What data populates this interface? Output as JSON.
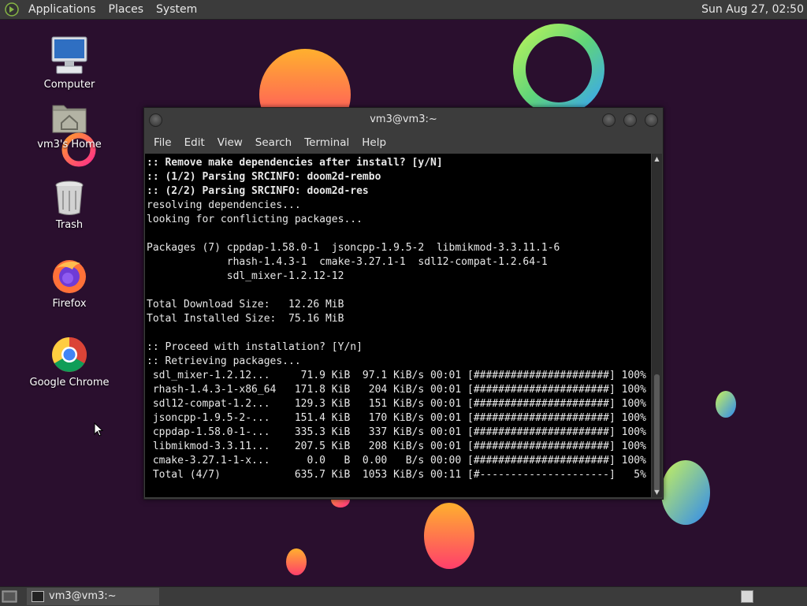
{
  "top_panel": {
    "menus": [
      "Applications",
      "Places",
      "System"
    ],
    "clock": "Sun Aug 27, 02:50"
  },
  "desktop_icons": [
    {
      "label": "Computer",
      "icon": "computer-icon"
    },
    {
      "label": "vm3's Home",
      "icon": "home-folder-icon"
    },
    {
      "label": "Trash",
      "icon": "trash-icon"
    },
    {
      "label": "Firefox",
      "icon": "firefox-icon"
    },
    {
      "label": "Google Chrome",
      "icon": "chrome-icon"
    }
  ],
  "terminal": {
    "title": "vm3@vm3:~",
    "menus": [
      "File",
      "Edit",
      "View",
      "Search",
      "Terminal",
      "Help"
    ],
    "lines": [
      {
        "text": ":: Remove make dependencies after install? [y/N]",
        "bold": true
      },
      {
        "text": ":: (1/2) Parsing SRCINFO: doom2d-rembo",
        "bold": true
      },
      {
        "text": ":: (2/2) Parsing SRCINFO: doom2d-res",
        "bold": true
      },
      {
        "text": "resolving dependencies...",
        "bold": false
      },
      {
        "text": "looking for conflicting packages...",
        "bold": false
      },
      {
        "text": "",
        "bold": false
      },
      {
        "text": "Packages (7) cppdap-1.58.0-1  jsoncpp-1.9.5-2  libmikmod-3.3.11.1-6",
        "bold": false
      },
      {
        "text": "             rhash-1.4.3-1  cmake-3.27.1-1  sdl12-compat-1.2.64-1",
        "bold": false
      },
      {
        "text": "             sdl_mixer-1.2.12-12",
        "bold": false
      },
      {
        "text": "",
        "bold": false
      },
      {
        "text": "Total Download Size:   12.26 MiB",
        "bold": false
      },
      {
        "text": "Total Installed Size:  75.16 MiB",
        "bold": false
      },
      {
        "text": "",
        "bold": false
      },
      {
        "text": ":: Proceed with installation? [Y/n]",
        "bold": false
      },
      {
        "text": ":: Retrieving packages...",
        "bold": false
      },
      {
        "text": " sdl_mixer-1.2.12...     71.9 KiB  97.1 KiB/s 00:01 [######################] 100%",
        "bold": false
      },
      {
        "text": " rhash-1.4.3-1-x86_64   171.8 KiB   204 KiB/s 00:01 [######################] 100%",
        "bold": false
      },
      {
        "text": " sdl12-compat-1.2...    129.3 KiB   151 KiB/s 00:01 [######################] 100%",
        "bold": false
      },
      {
        "text": " jsoncpp-1.9.5-2-...    151.4 KiB   170 KiB/s 00:01 [######################] 100%",
        "bold": false
      },
      {
        "text": " cppdap-1.58.0-1-...    335.3 KiB   337 KiB/s 00:01 [######################] 100%",
        "bold": false
      },
      {
        "text": " libmikmod-3.3.11...    207.5 KiB   208 KiB/s 00:01 [######################] 100%",
        "bold": false
      },
      {
        "text": " cmake-3.27.1-1-x...      0.0   B  0.00   B/s 00:00 [######################] 100%",
        "bold": false
      },
      {
        "text": " Total (4/7)            635.7 KiB  1053 KiB/s 00:11 [#---------------------]   5%",
        "bold": false
      }
    ]
  },
  "taskbar": {
    "task_label": "vm3@vm3:~"
  },
  "colors": {
    "wallpaper_bg": "#2a0f2e",
    "panel_bg": "#3b3b3b",
    "terminal_bg": "#000000"
  }
}
